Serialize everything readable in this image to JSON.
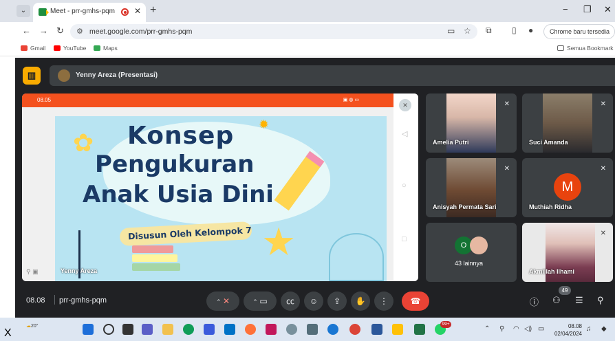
{
  "browser": {
    "tab_title": "Meet - prr-gmhs-pqm",
    "url": "meet.google.com/prr-gmhs-pqm",
    "update_button": "Chrome baru tersedia",
    "window": {
      "minimize": "−",
      "maximize": "❐",
      "close": "✕"
    }
  },
  "bookmarks": {
    "items": [
      "Gmail",
      "YouTube",
      "Maps"
    ],
    "all_bookmarks": "Semua Bookmark"
  },
  "meet": {
    "presenter_bar": "Yenny Areza (Presentasi)",
    "main_tile_name": "Yenny Areza",
    "phone_status_time": "08.05",
    "slide": {
      "line1": "Konsep",
      "line2": "Pengukuran",
      "line3": "Anak Usia Dini",
      "subtitle": "Disusun Oleh Kelompok 7"
    },
    "participants": [
      {
        "name": "Amelia Putri"
      },
      {
        "name": "Suci Amanda"
      },
      {
        "name": "Anisyah Permata Sari"
      },
      {
        "name": "Muthiah Ridha",
        "initial": "M"
      },
      {
        "name": "43 lainnya",
        "initial": "O"
      },
      {
        "name": "Akmillah Ilhami"
      }
    ],
    "bottom": {
      "time": "08.08",
      "code": "prr-gmhs-pqm",
      "people_count": "49"
    }
  },
  "taskbar": {
    "temperature": "20°",
    "badge": "99+",
    "clock_time": "08.08",
    "clock_date": "02/04/2024"
  },
  "stray_char": "X",
  "colors": {
    "meet_bg": "#202124",
    "tile_bg": "#3c4043",
    "end_call": "#ea4335",
    "accent_yellow": "#f9ab00"
  }
}
